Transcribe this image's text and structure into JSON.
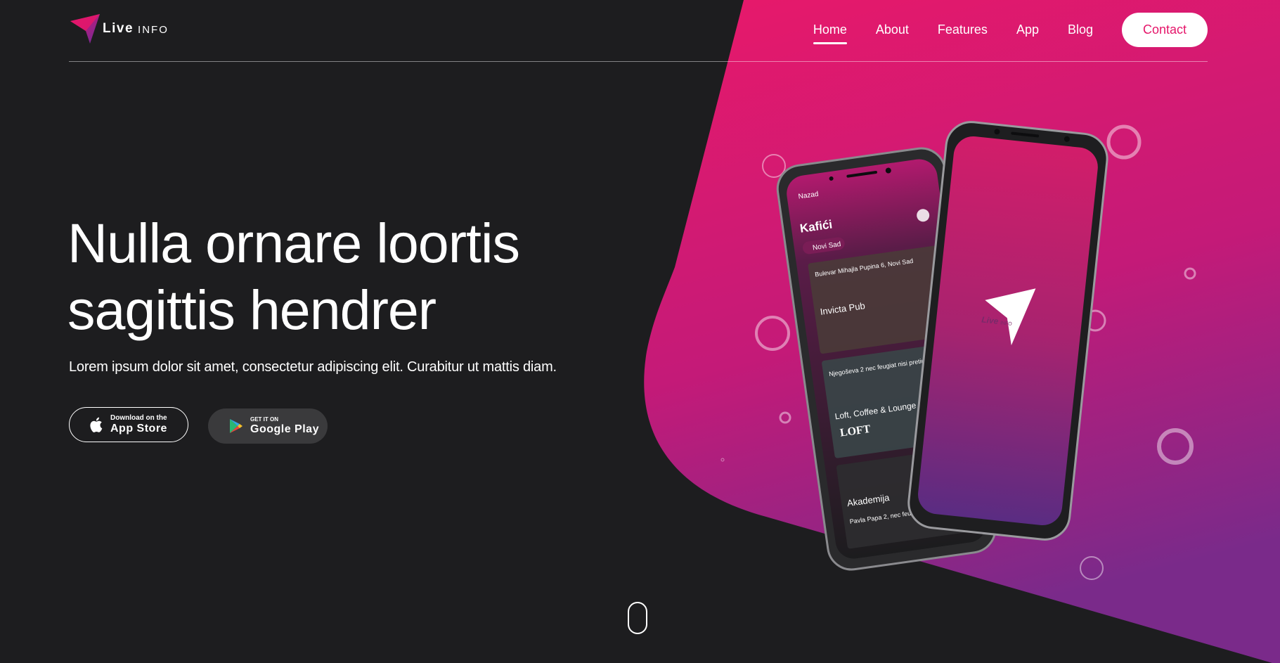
{
  "brand": {
    "logo_live": "Live",
    "logo_info": "INFO"
  },
  "nav": {
    "items": [
      {
        "label": "Home",
        "active": true
      },
      {
        "label": "About"
      },
      {
        "label": "Features"
      },
      {
        "label": "App"
      },
      {
        "label": "Blog"
      }
    ],
    "contact_label": "Contact"
  },
  "hero": {
    "title_line1": "Nulla ornare loortis",
    "title_line2": "sagittis hendrer",
    "subtitle": "Lorem ipsum dolor sit amet, consectetur adipiscing elit. Curabitur ut mattis diam."
  },
  "stores": {
    "appstore": {
      "small": "Download on the",
      "big": "App Store",
      "icon": "apple-icon"
    },
    "googleplay": {
      "small": "GET IT ON",
      "big": "Google Play",
      "icon": "google-play-icon"
    }
  },
  "phone_screen": {
    "back_label": "Nazad",
    "title": "Kafići",
    "city_chip": "Novi Sad",
    "cards": [
      {
        "address": "Bulevar Mihajla Pupina 6, Novi Sad",
        "name": "Invicta Pub"
      },
      {
        "address": "Njegoševa 2 nec feugiat nisi pretium, Novi Sad",
        "name": "Loft, Coffee & Lounge Bar",
        "sign": "LOFT"
      },
      {
        "address": "Pavla Papa 2, nec feugiat nisi pretium, Novi Sad",
        "name": "Akademija"
      }
    ]
  },
  "phone_splash": {
    "logo_live": "Live",
    "logo_info": "INFO"
  },
  "colors": {
    "accent": "#e5166a",
    "accent_purple": "#7b2a8f",
    "background": "#1d1d1f"
  }
}
